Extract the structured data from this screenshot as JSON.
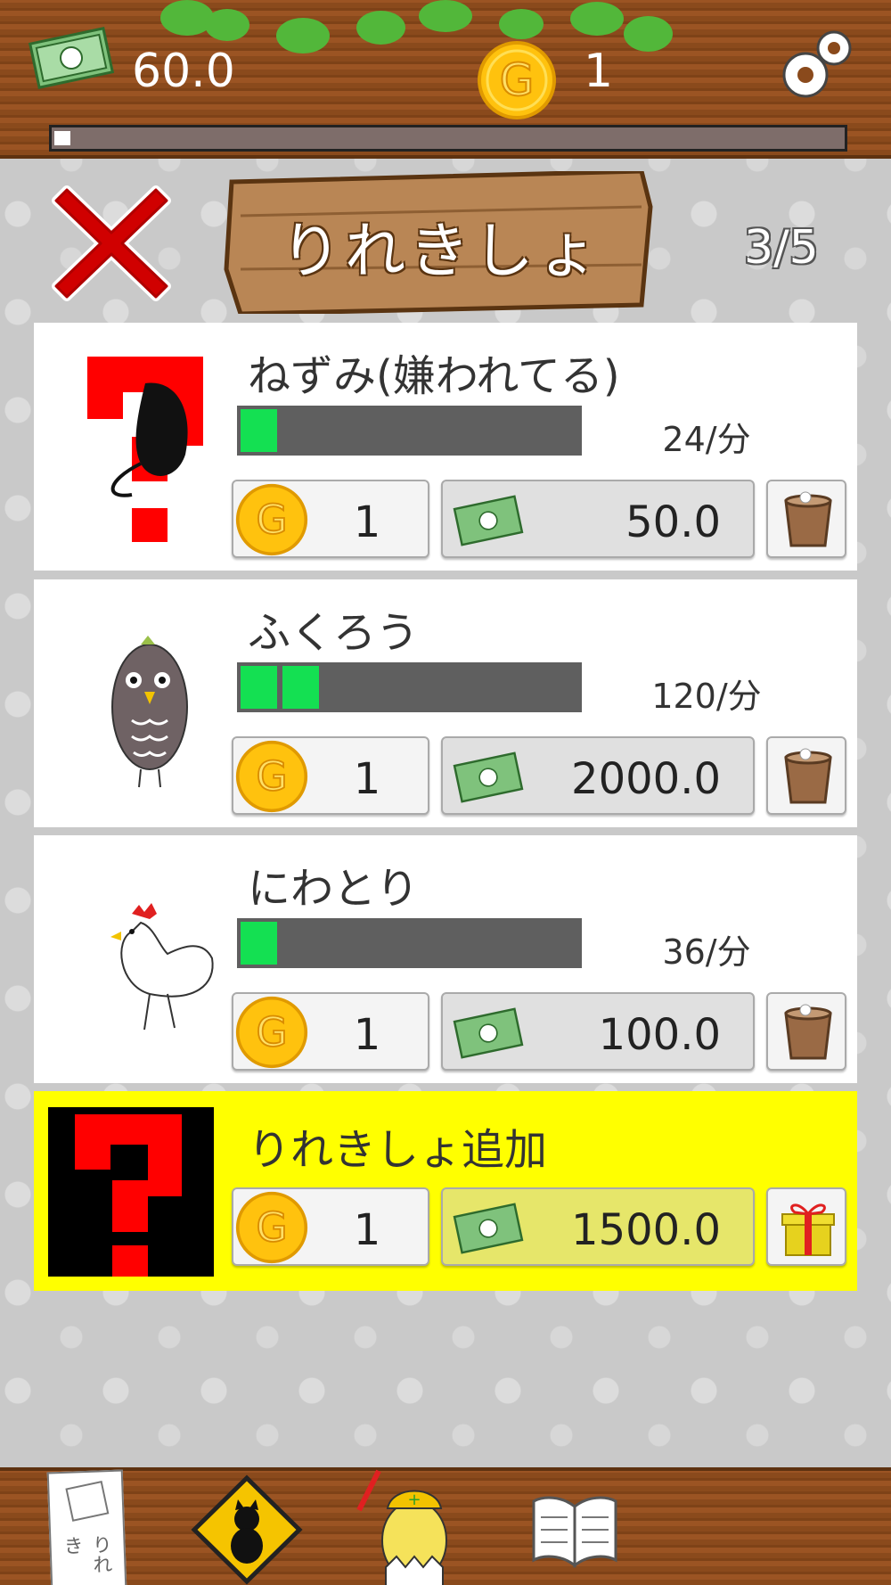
{
  "status": {
    "money": "60.0",
    "gold": "1",
    "progress_fraction": 0.02
  },
  "header": {
    "title": "りれきしょ",
    "page_counter": "3/5"
  },
  "cards": [
    {
      "name": "ねずみ(嫌われてる)",
      "rate": "24/分",
      "filled_segments": 1,
      "gold_cost": "1",
      "money_cost": "50.0"
    },
    {
      "name": "ふくろう",
      "rate": "120/分",
      "filled_segments": 2,
      "gold_cost": "1",
      "money_cost": "2000.0"
    },
    {
      "name": "にわとり",
      "rate": "36/分",
      "filled_segments": 1,
      "gold_cost": "1",
      "money_cost": "100.0"
    }
  ],
  "add_card": {
    "name": "りれきしょ追加",
    "gold_cost": "1",
    "money_cost": "1500.0"
  },
  "bottom_nav": {
    "tabs": [
      {
        "icon": "resume-paper-icon",
        "label": "りれき"
      },
      {
        "icon": "cat-warning-sign-icon"
      },
      {
        "icon": "worker-chick-icon"
      },
      {
        "icon": "open-book-icon"
      }
    ]
  },
  "colors": {
    "wood": "#8a4a1c",
    "progress_green": "#14e052",
    "add_card_yellow": "#ffff00",
    "close_red": "#d00000"
  }
}
